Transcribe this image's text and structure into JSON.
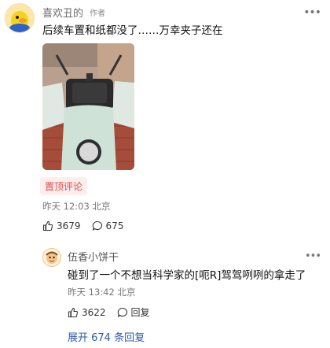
{
  "main_comment": {
    "author": "喜欢丑的",
    "author_tag": "作者",
    "text": "后续车置和纸都没了……万幸夹子还在",
    "pin_label": "置顶评论",
    "time": "昨天 12:03 北京",
    "likes": "3679",
    "replies": "675"
  },
  "reply": {
    "author": "伍香小饼干",
    "text": "碰到了一个不想当科学家的[呃R]驾驾咧咧的拿走了",
    "time": "昨天 13:42 北京",
    "likes": "3622",
    "reply_label": "回复"
  },
  "expand_label": "展开 674 条回复",
  "icons": {
    "more": "more-icon",
    "like": "thumb-up-icon",
    "comment": "comment-bubble-icon"
  },
  "colors": {
    "pin_text": "#e04a4a",
    "pin_bg": "#fdeeee",
    "link": "#2a5aa8"
  }
}
